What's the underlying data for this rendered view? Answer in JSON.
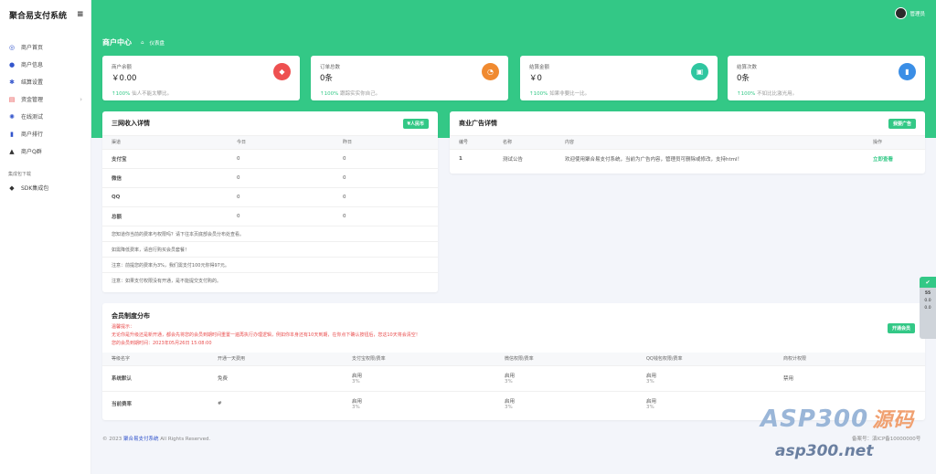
{
  "brand": "聚合易支付系统",
  "sidebar": {
    "items": [
      {
        "label": "商户首页",
        "icon": "compass-icon",
        "glyph": "◎",
        "color": "#3355cc"
      },
      {
        "label": "商户信息",
        "icon": "user-icon",
        "glyph": "●",
        "color": "#3355cc"
      },
      {
        "label": "结算设置",
        "icon": "gear-icon",
        "glyph": "✱",
        "color": "#3355cc"
      },
      {
        "label": "资金管理",
        "icon": "document-icon",
        "glyph": "▤",
        "color": "#e94e4e"
      },
      {
        "label": "在线测试",
        "icon": "settings-icon",
        "glyph": "✺",
        "color": "#3355cc"
      },
      {
        "label": "商户排行",
        "icon": "bar-chart-icon",
        "glyph": "▮",
        "color": "#3355cc"
      },
      {
        "label": "商户Q群",
        "icon": "graduation-cap-icon",
        "glyph": "▲",
        "color": "#333"
      }
    ],
    "section_label": "集成包下载",
    "sdk_item": {
      "label": "SDK集成包",
      "icon": "diamond-icon",
      "glyph": "◆"
    }
  },
  "header": {
    "username": "管理员",
    "page_title": "商户中心",
    "breadcrumb": "仪表盘"
  },
  "stats": [
    {
      "label": "商户余额",
      "value": "￥0.00",
      "pct": "100%",
      "note": "仙人不能太攀比。",
      "icon": "diamond-icon",
      "glyph": "◆",
      "color": "#ee5050"
    },
    {
      "label": "订单总数",
      "value": "0条",
      "pct": "100%",
      "note": "跟踪实实你自己。",
      "icon": "pie-chart-icon",
      "glyph": "◔",
      "color": "#f08a30"
    },
    {
      "label": "结算金额",
      "value": "￥0",
      "pct": "100%",
      "note": "如果非要比一比。",
      "icon": "wallet-icon",
      "glyph": "▣",
      "color": "#2fc6a0"
    },
    {
      "label": "结算次数",
      "value": "0条",
      "pct": "100%",
      "note": "不如比比激光用。",
      "icon": "bar-chart-icon",
      "glyph": "▮",
      "color": "#3a8ee6"
    }
  ],
  "income": {
    "title": "三网收入详情",
    "button": "¥人民币",
    "columns": [
      "渠道",
      "今日",
      "昨日"
    ],
    "rows": [
      {
        "name": "支付宝",
        "today": "0",
        "yesterday": "0"
      },
      {
        "name": "微信",
        "today": "0",
        "yesterday": "0"
      },
      {
        "name": "QQ",
        "today": "0",
        "yesterday": "0"
      },
      {
        "name": "总额",
        "today": "0",
        "yesterday": "0"
      }
    ],
    "notes": [
      "您知道你当前的费率与权限吗？请下往本页底部会员分布处查看。",
      "如需降低费率，请自行购买会员套餐！",
      "注意：前提您的费率为3%，我们需支付100元你得97元。",
      "注意：如果支付权限没有开通，是不能提交支付购的。"
    ]
  },
  "ads": {
    "title": "商业广告详情",
    "button": "我要广告",
    "columns": [
      "编号",
      "名称",
      "内容",
      "操作"
    ],
    "rows": [
      {
        "id": "1",
        "name": "测试公告",
        "content": "欢迎使用聚合易支付系统，当前为广告内容，管理员可删除或修改，支持html！",
        "action": "立即查看"
      }
    ]
  },
  "membership": {
    "title": "会员制度分布",
    "tip_label": "温馨提示：",
    "tip_text": "无论你是升级还是新开通，都会先将您的会员到期时间重置一遍再执行办理逻辑，例如你本身还有10天到期，在你点下确认按钮后，您这10天将会清空！",
    "expire": "您的会员到期时间：2023年05月26日 15:08:00",
    "button": "开通会员",
    "columns": [
      "等级名字",
      "开通一天费用",
      "支付宝权限/费率",
      "微信权限/费率",
      "QQ钱包权限/费率",
      "商权计权限"
    ],
    "rows": [
      {
        "name": "系统默认",
        "fee": "免费",
        "alipay": "启用",
        "alipay_rate": "",
        "wechat": "启用",
        "wechat_rate": "",
        "qq": "启用",
        "qq_rate": "",
        "perm": "禁用"
      },
      {
        "name": "当前费率",
        "fee": "#",
        "alipay": "启用",
        "alipay_rate": "3%",
        "wechat": "启用",
        "wechat_rate": "3%",
        "qq": "启用",
        "qq_rate": "3%",
        "perm": ""
      }
    ],
    "row1_rates": [
      "3%",
      "3%",
      "3%"
    ]
  },
  "footer": {
    "prefix": "© 2023",
    "link": "聚合易支付系统",
    "suffix": "All Rights Reserved.",
    "icp": "备案号：滇ICP备10000000号"
  },
  "widget": {
    "top": "✔",
    "line1": "55",
    "line2": "0.0",
    "line3": "0.0"
  },
  "watermark": {
    "line1": "ASP300",
    "line1_cn": "源码",
    "line2": "asp300.net"
  }
}
